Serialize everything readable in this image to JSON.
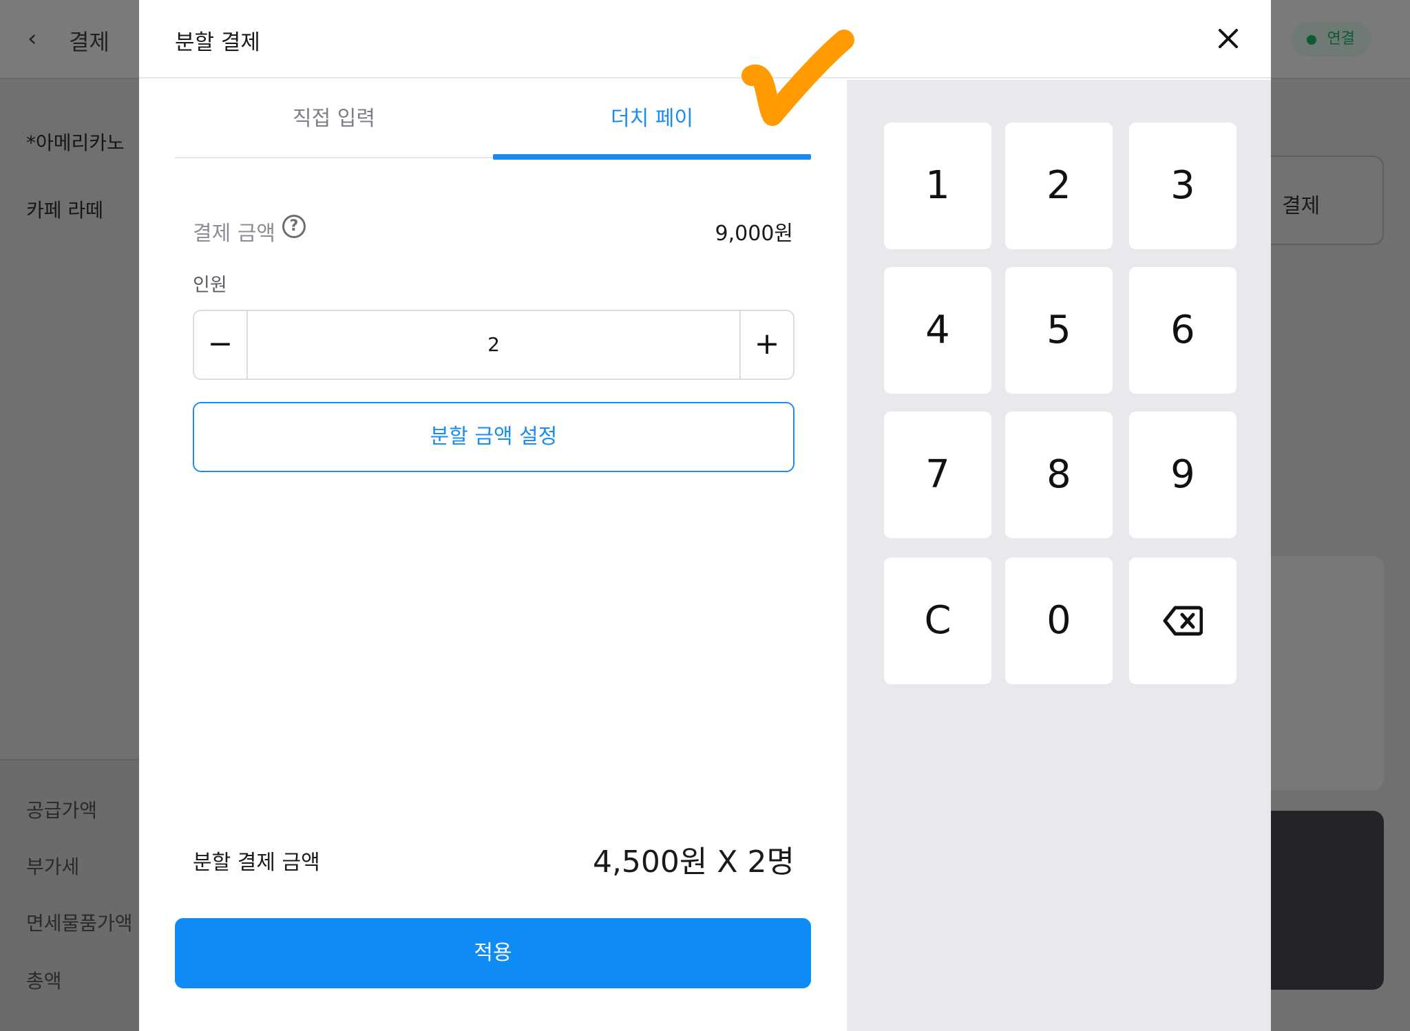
{
  "background": {
    "header_title": "결제",
    "back_icon": "chevron-left-icon",
    "status_label": "연결",
    "menu_items": [
      "*아메리카노",
      "카페 라떼"
    ],
    "summary_labels": [
      "공급가액",
      "부가세",
      "면세물품가액",
      "총액"
    ],
    "right_button_label": "결제"
  },
  "modal": {
    "title": "분할 결제",
    "tabs": [
      {
        "label": "직접 입력",
        "active": false
      },
      {
        "label": "더치 페이",
        "active": true
      }
    ],
    "amount_label": "결제 금액",
    "amount_value": "9,000원",
    "people_label": "인원",
    "people_count": "2",
    "minus_symbol": "−",
    "plus_symbol": "+",
    "split_setting_button": "분할 금액 설정",
    "split_result_label": "분할 결제 금액",
    "split_result_value": "4,500원 X 2명",
    "apply_button": "적용"
  },
  "keypad": {
    "keys": [
      "1",
      "2",
      "3",
      "4",
      "5",
      "6",
      "7",
      "8",
      "9",
      "C",
      "0"
    ],
    "backspace_icon": "backspace-icon"
  },
  "colors": {
    "accent": "#0f8bf6",
    "tab_active": "#1a8cf0",
    "keypad_bg": "#e8e9ec",
    "checkmark": "#ff9a00"
  }
}
